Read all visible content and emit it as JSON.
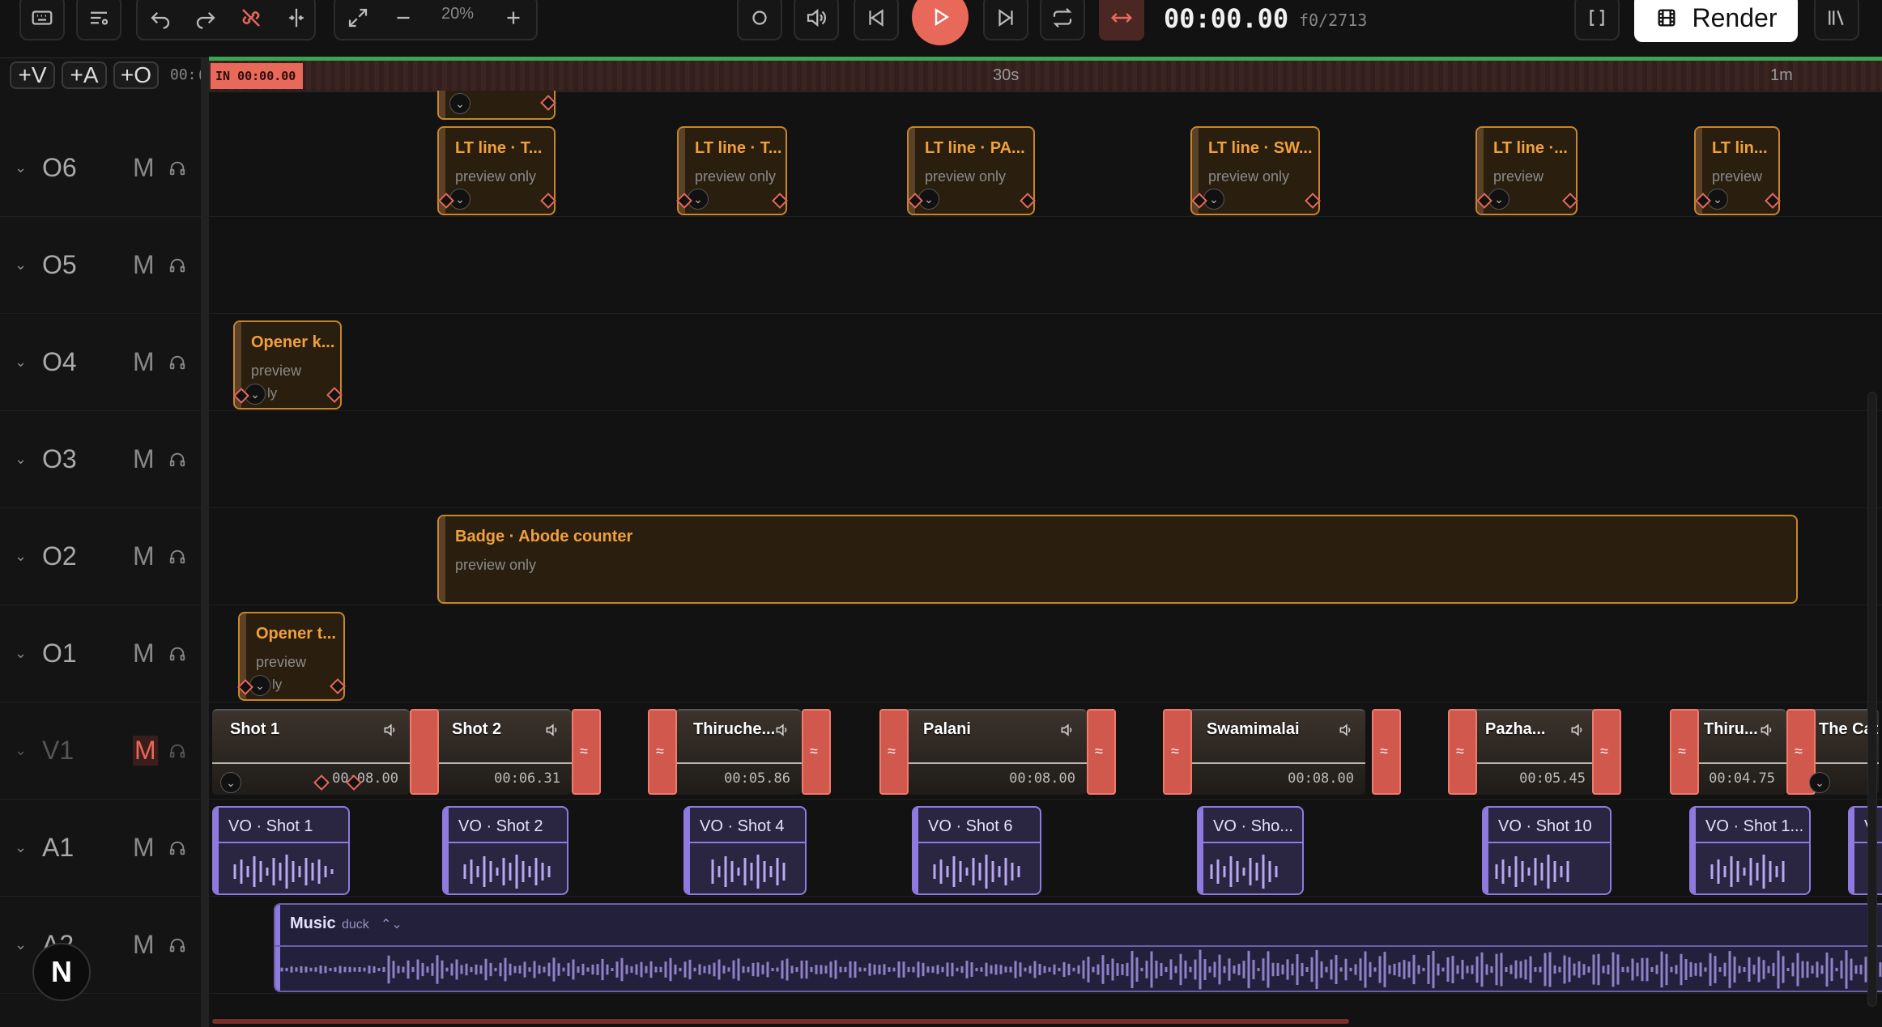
{
  "toolbar": {
    "zoom": "20%",
    "timecode": "00:00.00",
    "frame": "f0/2713",
    "render_label": "Render"
  },
  "add_buttons": {
    "video": "+V",
    "audio": "+A",
    "overlay": "+O",
    "partial_time": "00:("
  },
  "ruler": {
    "in_label": "IN 00:00.00",
    "mark_30s": "30s",
    "mark_1m": "1m"
  },
  "tracks": [
    {
      "name": "O6",
      "mute": "M"
    },
    {
      "name": "O5",
      "mute": "M"
    },
    {
      "name": "O4",
      "mute": "M"
    },
    {
      "name": "O3",
      "mute": "M"
    },
    {
      "name": "O2",
      "mute": "M"
    },
    {
      "name": "O1",
      "mute": "M"
    },
    {
      "name": "V1",
      "mute": "M"
    },
    {
      "name": "A1",
      "mute": "M"
    },
    {
      "name": "A2",
      "mute": "M"
    }
  ],
  "o6_clips": [
    {
      "title": "LT line · T...",
      "sub": "preview only"
    },
    {
      "title": "LT line · T...",
      "sub": "preview only"
    },
    {
      "title": "LT line · PA...",
      "sub": "preview only"
    },
    {
      "title": "LT line · SW...",
      "sub": "preview only"
    },
    {
      "title": "LT line ·...",
      "sub": "preview"
    },
    {
      "title": "LT lin...",
      "sub": "preview"
    }
  ],
  "o4_clip": {
    "title": "Opener k...",
    "sub": "preview",
    "sub2": "ly"
  },
  "o2_clip": {
    "title": "Badge · Abode counter",
    "sub": "preview only"
  },
  "o1_clip": {
    "title": "Opener t...",
    "sub": "preview",
    "sub2": "ly"
  },
  "v1_clips": [
    {
      "label": "Shot 1",
      "dur": "00:08.00"
    },
    {
      "label": "Shot 2",
      "dur": "00:06.31"
    },
    {
      "label": "Thiruche...",
      "dur": "00:05.86"
    },
    {
      "label": "Palani",
      "dur": "00:08.00"
    },
    {
      "label": "Swamimalai",
      "dur": "00:08.00"
    },
    {
      "label": "Pazha...",
      "dur": "00:05.45"
    },
    {
      "label": "Thiru...",
      "dur": "00:04.75"
    },
    {
      "label": "The Cat",
      "dur": ""
    }
  ],
  "a1_clips": [
    {
      "label": "VO · Shot 1"
    },
    {
      "label": "VO · Shot 2"
    },
    {
      "label": "VO · Shot 4"
    },
    {
      "label": "VO · Shot 6"
    },
    {
      "label": "VO · Sho..."
    },
    {
      "label": "VO · Shot 10"
    },
    {
      "label": "VO · Shot 1..."
    },
    {
      "label": "V"
    }
  ],
  "music": {
    "label": "Music",
    "tag": "duck"
  },
  "colors": {
    "accent": "#e8685a",
    "overlay": "#c8852a",
    "audio": "#8f7ae0",
    "progress": "#3aa54f"
  }
}
